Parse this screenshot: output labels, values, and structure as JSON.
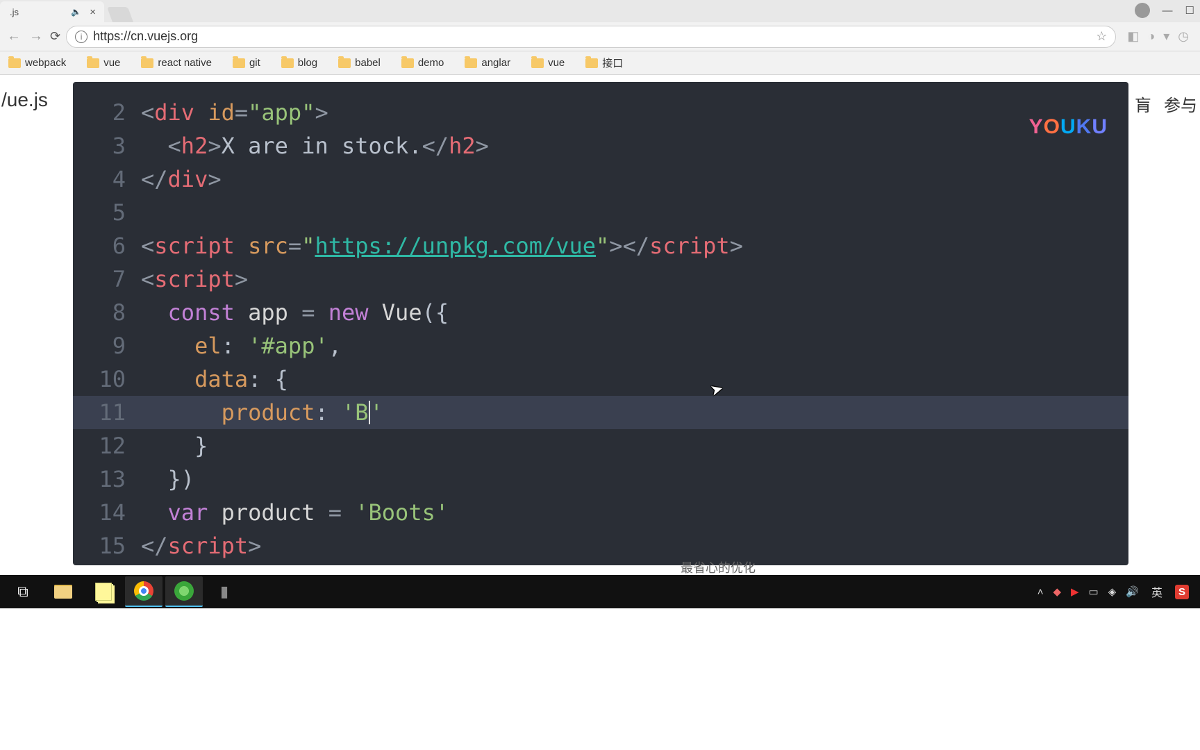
{
  "browser": {
    "tab_title": ".js",
    "url": "https://cn.vuejs.org",
    "bookmarks": [
      "webpack",
      "vue",
      "react native",
      "git",
      "blog",
      "babel",
      "demo",
      "anglar",
      "vue",
      "接口"
    ]
  },
  "page": {
    "left_text": "/ue.js",
    "right_text_1": "肓",
    "right_text_2": "参与",
    "youku": "YOUKU",
    "bottom_slice": "最省心的优化"
  },
  "code": {
    "lines": [
      {
        "n": "2",
        "segs": [
          {
            "t": "<",
            "c": "pun"
          },
          {
            "t": "div ",
            "c": "tag"
          },
          {
            "t": "id",
            "c": "attr"
          },
          {
            "t": "=",
            "c": "pun"
          },
          {
            "t": "\"app\"",
            "c": "str"
          },
          {
            "t": ">",
            "c": "pun"
          }
        ]
      },
      {
        "n": "3",
        "indent": 1,
        "segs": [
          {
            "t": "<",
            "c": "pun"
          },
          {
            "t": "h2",
            "c": "tag"
          },
          {
            "t": ">",
            "c": "pun"
          },
          {
            "t": "X are in stock.",
            "c": "plain"
          },
          {
            "t": "</",
            "c": "pun"
          },
          {
            "t": "h2",
            "c": "tag"
          },
          {
            "t": ">",
            "c": "pun"
          }
        ]
      },
      {
        "n": "4",
        "segs": [
          {
            "t": "</",
            "c": "pun"
          },
          {
            "t": "div",
            "c": "tag"
          },
          {
            "t": ">",
            "c": "pun"
          }
        ]
      },
      {
        "n": "5",
        "segs": []
      },
      {
        "n": "6",
        "segs": [
          {
            "t": "<",
            "c": "pun"
          },
          {
            "t": "script ",
            "c": "tag"
          },
          {
            "t": "src",
            "c": "attr"
          },
          {
            "t": "=",
            "c": "pun"
          },
          {
            "t": "\"",
            "c": "str"
          },
          {
            "t": "https://unpkg.com/vue",
            "c": "link"
          },
          {
            "t": "\"",
            "c": "str"
          },
          {
            "t": ">",
            "c": "pun"
          },
          {
            "t": "</",
            "c": "pun"
          },
          {
            "t": "script",
            "c": "tag"
          },
          {
            "t": ">",
            "c": "pun"
          }
        ]
      },
      {
        "n": "7",
        "segs": [
          {
            "t": "<",
            "c": "pun"
          },
          {
            "t": "script",
            "c": "tag"
          },
          {
            "t": ">",
            "c": "pun"
          }
        ]
      },
      {
        "n": "8",
        "indent": 1,
        "segs": [
          {
            "t": "const ",
            "c": "kw"
          },
          {
            "t": "app ",
            "c": "ident"
          },
          {
            "t": "= ",
            "c": "pun"
          },
          {
            "t": "new ",
            "c": "kw"
          },
          {
            "t": "Vue",
            "c": "fn"
          },
          {
            "t": "({",
            "c": "plain"
          }
        ]
      },
      {
        "n": "9",
        "indent": 2,
        "segs": [
          {
            "t": "el",
            "c": "prop"
          },
          {
            "t": ": ",
            "c": "plain"
          },
          {
            "t": "'#app'",
            "c": "str"
          },
          {
            "t": ",",
            "c": "plain"
          }
        ]
      },
      {
        "n": "10",
        "indent": 2,
        "segs": [
          {
            "t": "data",
            "c": "prop"
          },
          {
            "t": ": {",
            "c": "plain"
          }
        ]
      },
      {
        "n": "11",
        "indent": 3,
        "hl": true,
        "segs": [
          {
            "t": "product",
            "c": "prop"
          },
          {
            "t": ": ",
            "c": "plain"
          },
          {
            "t": "'B",
            "c": "str"
          },
          {
            "caret": true
          },
          {
            "t": "'",
            "c": "str"
          }
        ]
      },
      {
        "n": "12",
        "indent": 2,
        "segs": [
          {
            "t": "}",
            "c": "plain"
          }
        ]
      },
      {
        "n": "13",
        "indent": 1,
        "segs": [
          {
            "t": "})",
            "c": "plain"
          }
        ]
      },
      {
        "n": "14",
        "indent": 1,
        "segs": [
          {
            "t": "var ",
            "c": "kw"
          },
          {
            "t": "product ",
            "c": "ident"
          },
          {
            "t": "= ",
            "c": "pun"
          },
          {
            "t": "'Boots'",
            "c": "str"
          }
        ]
      },
      {
        "n": "15",
        "segs": [
          {
            "t": "</",
            "c": "pun"
          },
          {
            "t": "script",
            "c": "tag"
          },
          {
            "t": ">",
            "c": "pun"
          }
        ]
      }
    ]
  },
  "tray": {
    "lang": "英"
  }
}
